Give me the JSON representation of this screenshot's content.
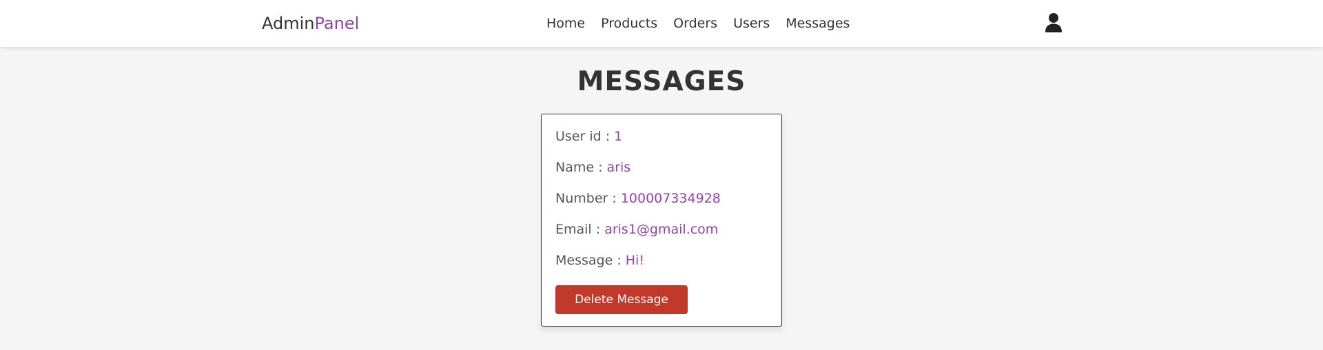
{
  "header": {
    "logo_main": "Admin",
    "logo_accent": "Panel",
    "nav": [
      "Home",
      "Products",
      "Orders",
      "Users",
      "Messages"
    ],
    "user_icon": "user-icon"
  },
  "page": {
    "title": "MESSAGES"
  },
  "message": {
    "user_id_label": "User id : ",
    "user_id": "1",
    "name_label": "Name : ",
    "name": "aris",
    "number_label": "Number : ",
    "number": "100007334928",
    "email_label": "Email : ",
    "email": "aris1@gmail.com",
    "message_label": "Message : ",
    "message": "Hi!",
    "delete_label": "Delete Message"
  },
  "colors": {
    "accent": "#8e44ad",
    "danger": "#c0392b",
    "background": "#f5f5f5",
    "text": "#333333"
  }
}
